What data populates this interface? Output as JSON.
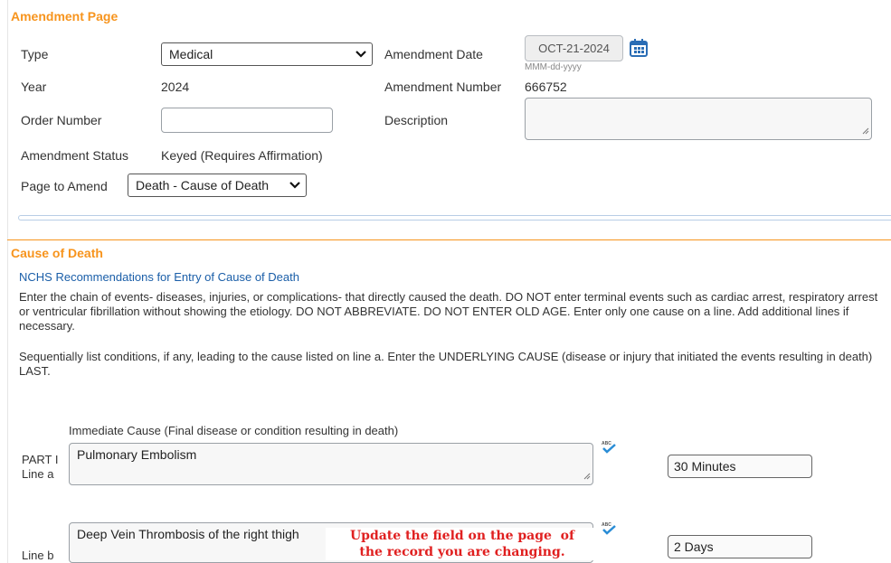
{
  "amendment": {
    "section_title": "Amendment Page",
    "type_label": "Type",
    "type_value": "Medical",
    "year_label": "Year",
    "year_value": "2024",
    "order_number_label": "Order Number",
    "order_number_value": "",
    "status_label": "Amendment Status",
    "status_value": "Keyed (Requires Affirmation)",
    "page_to_amend_label": "Page to Amend",
    "page_to_amend_value": "Death - Cause of Death",
    "date_label": "Amendment Date",
    "date_value": "OCT-21-2024",
    "date_format_hint": "MMM-dd-yyyy",
    "number_label": "Amendment Number",
    "number_value": "666752",
    "description_label": "Description",
    "description_value": ""
  },
  "cause_of_death": {
    "section_title": "Cause of Death",
    "nchs_link": "NCHS Recommendations for Entry of Cause of Death",
    "instructions_1": "Enter the chain of events- diseases, injuries, or complications- that directly caused the death. DO NOT enter terminal events such as cardiac arrest, respiratory arrest or ventricular fibrillation without showing the etiology. DO NOT ABBREVIATE. DO NOT ENTER OLD AGE. Enter only one cause on a line. Add additional lines if necessary.",
    "instructions_2": "Sequentially list conditions, if any, leading to the cause listed on line a. Enter the UNDERLYING CAUSE (disease or injury that initiated the events resulting in death) LAST.",
    "immediate_cause_label": "Immediate Cause (Final disease or condition resulting in death)",
    "part1_label": "PART I",
    "line_a_label": "Line a",
    "line_a_value": "Pulmonary Embolism",
    "line_a_interval": "30 Minutes",
    "line_b_label": "Line b",
    "line_b_value": "Deep Vein Thrombosis of the right thigh",
    "line_b_interval": "2 Days"
  },
  "annotation": {
    "line1": "Update the field on the page  of",
    "line2": "the record you are changing."
  },
  "icons": {
    "calendar": "calendar-icon",
    "spellcheck": "spellcheck-icon",
    "chevron": "chevron-down-icon",
    "resize": "resize-grip-icon"
  },
  "colors": {
    "section_title": "#f7941d",
    "link": "#1a5ea8",
    "calendar_icon": "#2a6db5",
    "annotation": "#e02020"
  }
}
